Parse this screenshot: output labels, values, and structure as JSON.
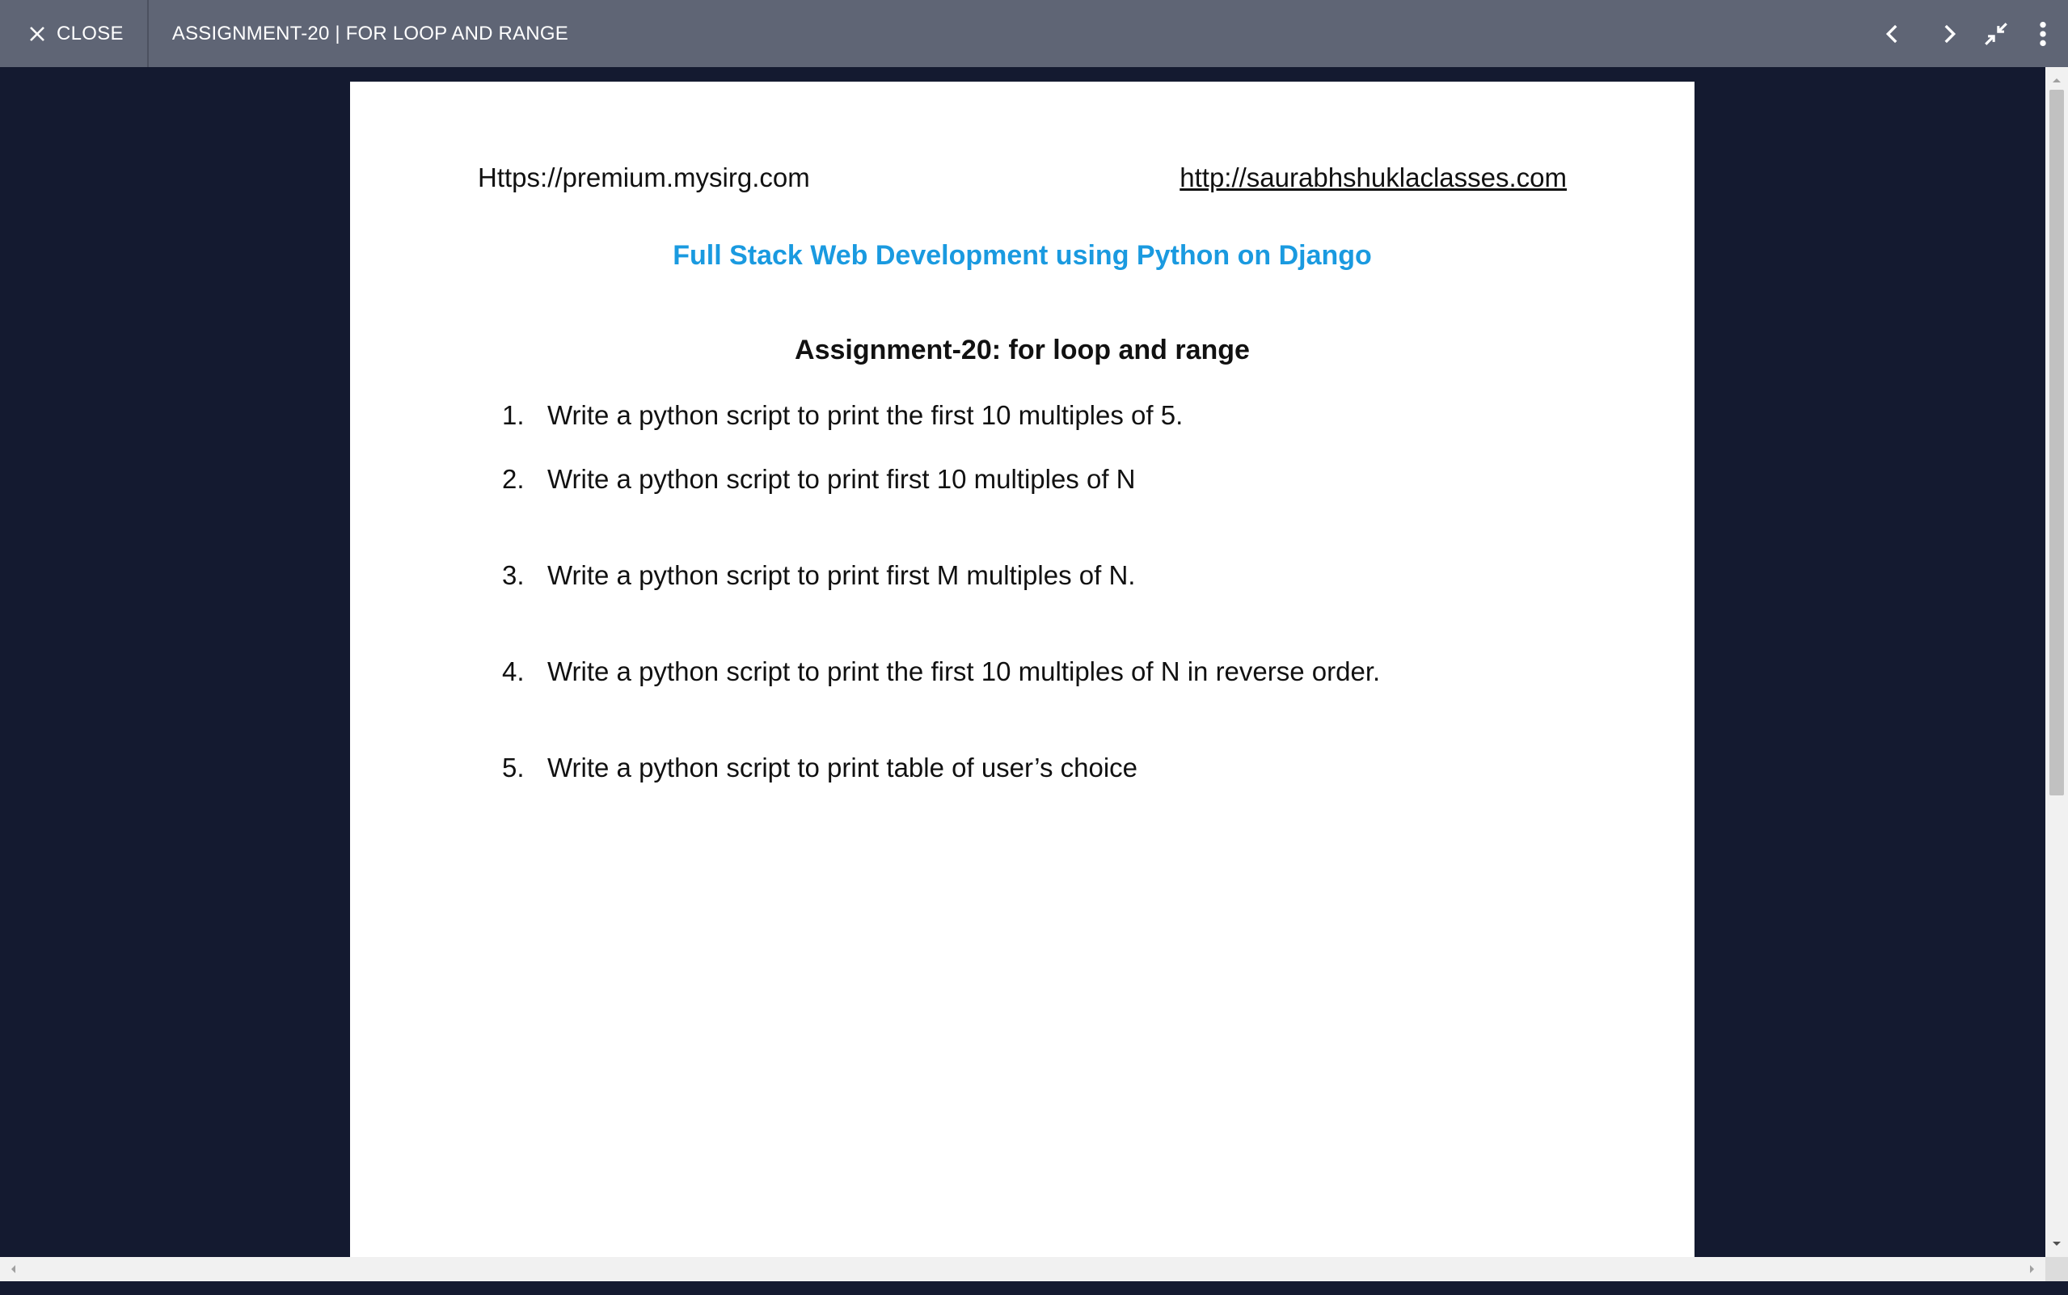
{
  "toolbar": {
    "close_label": "CLOSE",
    "document_title": "ASSIGNMENT-20 | FOR LOOP AND RANGE",
    "icons": [
      "close-icon",
      "chevron-left-icon",
      "chevron-right-icon",
      "exit-fullscreen-icon",
      "more-vertical-icon"
    ]
  },
  "document": {
    "header_left": "Https://premium.mysirg.com",
    "header_right": "http://saurabhshuklaclasses.com",
    "course_title": "Full Stack Web Development using Python on Django",
    "assignment_title": "Assignment-20: for loop and range",
    "questions": [
      {
        "num": "1.",
        "text": "Write a python script to print the first 10 multiples of 5."
      },
      {
        "num": "2.",
        "text": "Write a python script to print first 10 multiples of N"
      },
      {
        "num": "3.",
        "text": "Write a python script to print first M multiples of N."
      },
      {
        "num": "4.",
        "text": "Write a python script to print the first 10 multiples of N in reverse order."
      },
      {
        "num": "5.",
        "text": "Write a python script to print table of user’s choice"
      }
    ]
  },
  "colors": {
    "toolbar_bg": "#5f6575",
    "viewer_bg": "#141a30",
    "course_title": "#1a9ae0"
  }
}
